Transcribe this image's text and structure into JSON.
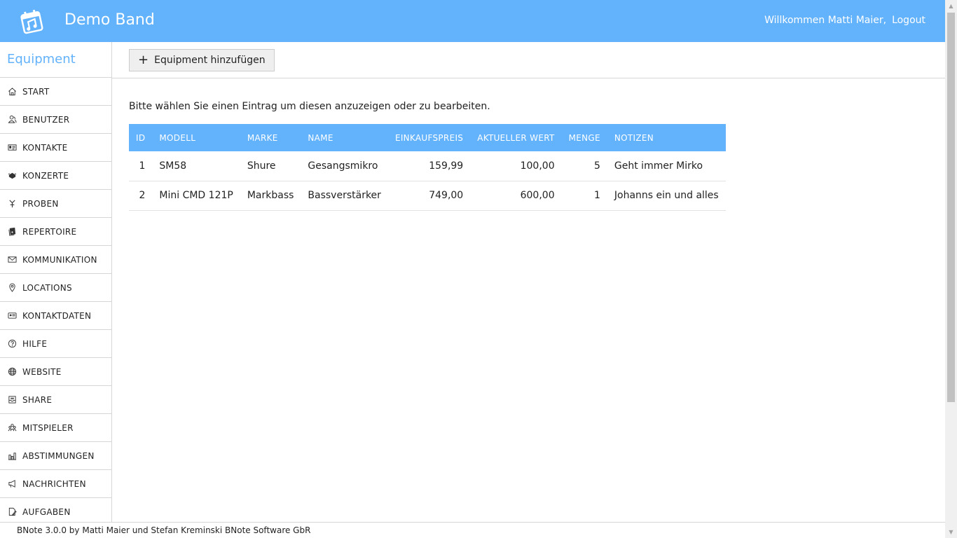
{
  "header": {
    "app_title": "Demo Band",
    "welcome": "Willkommen Matti Maier,",
    "logout": "Logout",
    "bg_color": "#63b2fc"
  },
  "sidebar": {
    "module_title": "Equipment",
    "items": [
      {
        "label": "START",
        "icon": "home-icon"
      },
      {
        "label": "BENUTZER",
        "icon": "user-icon"
      },
      {
        "label": "KONTAKTE",
        "icon": "contact-card-icon"
      },
      {
        "label": "KONZERTE",
        "icon": "concert-icon"
      },
      {
        "label": "PROBEN",
        "icon": "rehearsal-icon"
      },
      {
        "label": "REPERTOIRE",
        "icon": "repertoire-icon"
      },
      {
        "label": "KOMMUNIKATION",
        "icon": "envelope-icon"
      },
      {
        "label": "LOCATIONS",
        "icon": "map-pin-icon"
      },
      {
        "label": "KONTAKTDATEN",
        "icon": "contact-data-icon"
      },
      {
        "label": "HILFE",
        "icon": "help-icon"
      },
      {
        "label": "WEBSITE",
        "icon": "globe-icon"
      },
      {
        "label": "SHARE",
        "icon": "share-icon"
      },
      {
        "label": "MITSPIELER",
        "icon": "group-icon"
      },
      {
        "label": "ABSTIMMUNGEN",
        "icon": "bar-chart-icon"
      },
      {
        "label": "NACHRICHTEN",
        "icon": "megaphone-icon"
      },
      {
        "label": "AUFGABEN",
        "icon": "task-icon"
      }
    ]
  },
  "toolbar": {
    "add_label": "Equipment hinzufügen",
    "add_icon": "plus-icon"
  },
  "main": {
    "hint": "Bitte wählen Sie einen Eintrag um diesen anzuzeigen oder zu bearbeiten.",
    "table": {
      "headers": [
        "ID",
        "MODELL",
        "MARKE",
        "NAME",
        "EINKAUFSPREIS",
        "AKTUELLER WERT",
        "MENGE",
        "NOTIZEN"
      ],
      "rows": [
        [
          "1",
          "SM58",
          "Shure",
          "Gesangsmikro",
          "159,99",
          "100,00",
          "5",
          "Geht immer Mirko"
        ],
        [
          "2",
          "Mini CMD 121P",
          "Markbass",
          "Bassverstärker",
          "749,00",
          "600,00",
          "1",
          "Johanns ein und alles"
        ]
      ]
    }
  },
  "footer": {
    "text": "BNote 3.0.0 by Matti Maier und Stefan Kreminski BNote Software GbR"
  }
}
